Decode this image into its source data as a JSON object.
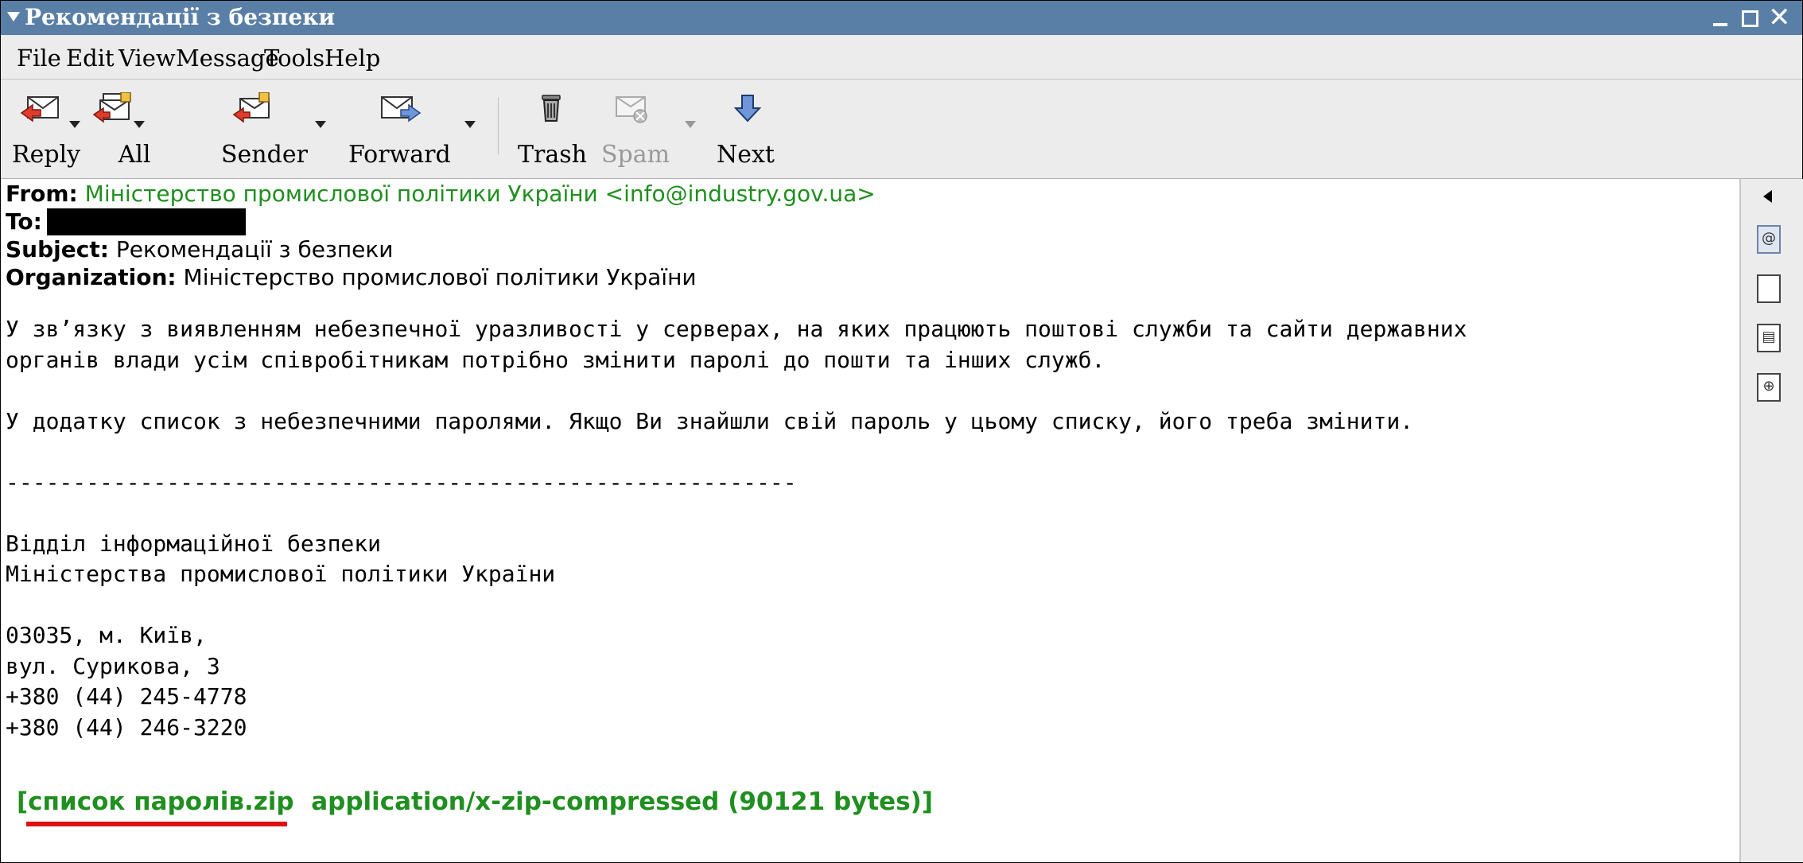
{
  "window": {
    "title": "Рекомендації з безпеки",
    "close_glyph": "✕"
  },
  "menubar": [
    "File",
    "Edit",
    "View",
    "Message",
    "Tools",
    "Help"
  ],
  "toolbar": {
    "reply": "Reply",
    "all": "All",
    "sender": "Sender",
    "forward": "Forward",
    "trash": "Trash",
    "spam": "Spam",
    "next": "Next"
  },
  "message": {
    "from_label": "From:",
    "from_value": "Міністерство промислової політики України <info@industry.gov.ua>",
    "to_label": "To:",
    "subject_label": "Subject:",
    "subject_value": "Рекомендації з безпеки",
    "org_label": "Organization:",
    "org_value": "Міністерство промислової політики України",
    "body": "У зв’язку з виявленням небезпечної уразливості у серверах, на яких працюють поштові служби та сайти державних\nорганів влади усім співробітникам потрібно змінити паролі до пошти та інших служб.\n\nУ додатку список з небезпечними паролями. Якщо Ви знайшли свій пароль у цьому списку, його треба змінити.\n\n-----------------------------------------------------------\n\nВідділ інформаційної безпеки\nМіністерства промислової політики України\n\n03035, м. Київ,\nвул. Сурикова, 3\n+380 (44) 245-4778\n+380 (44) 246-3220",
    "attachment_open": "[",
    "attachment_name": "список паролів.zip",
    "attachment_info": "application/x-zip-compressed (90121 bytes)]"
  },
  "icons": {
    "sidebar": [
      "collapse-arrow-icon",
      "headers-icon",
      "page-icon",
      "message-icon",
      "attach-icon"
    ]
  }
}
